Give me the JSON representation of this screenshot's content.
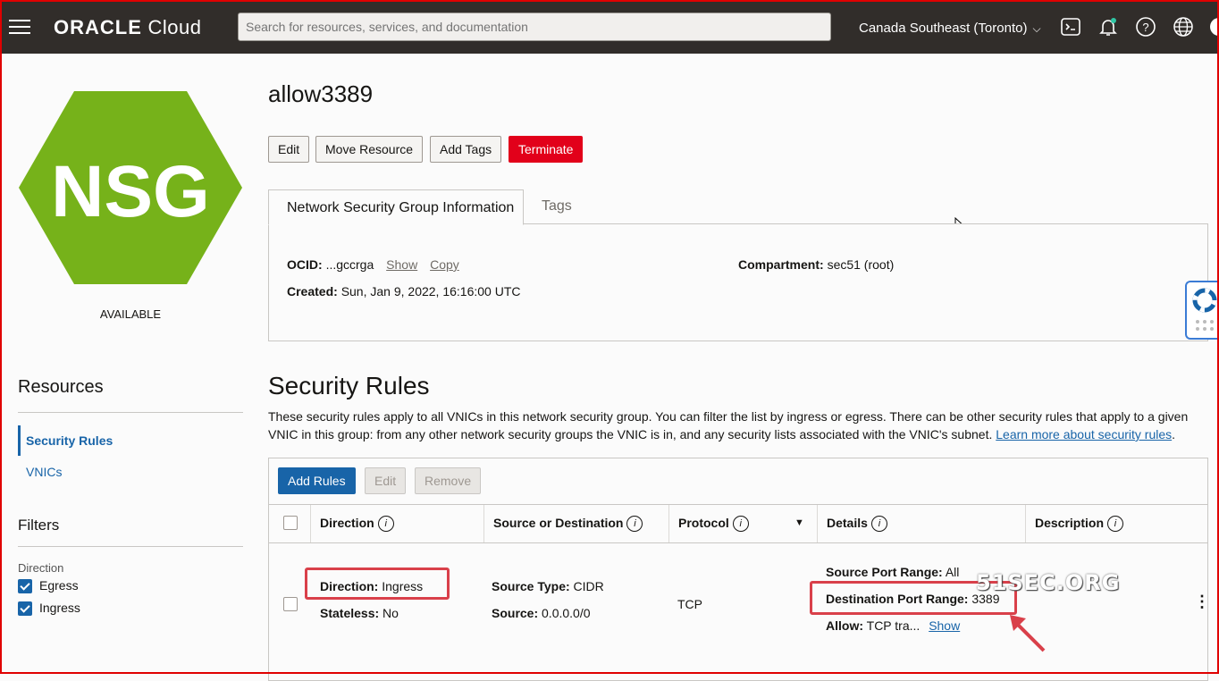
{
  "header": {
    "logo_bold": "ORACLE",
    "logo_light": " Cloud",
    "search_placeholder": "Search for resources, services, and documentation",
    "region": "Canada Southeast (Toronto)",
    "icons": [
      "menu-icon",
      "cloud-shell-icon",
      "notifications-icon",
      "help-icon",
      "language-icon"
    ]
  },
  "badge": {
    "text": "NSG",
    "color": "#76b21a",
    "status": "AVAILABLE"
  },
  "resources": {
    "title": "Resources",
    "items": [
      "Security Rules",
      "VNICs"
    ]
  },
  "filters": {
    "title": "Filters",
    "direction_label": "Direction",
    "options": [
      "Egress",
      "Ingress"
    ]
  },
  "page": {
    "title": "allow3389",
    "actions": [
      "Edit",
      "Move Resource",
      "Add Tags",
      "Terminate"
    ],
    "tabs": [
      "Network Security Group Information",
      "Tags"
    ]
  },
  "info": {
    "ocid_label": "OCID:",
    "ocid_value": "...gccrga",
    "show": "Show",
    "copy": "Copy",
    "created_label": "Created:",
    "created_value": "Sun, Jan 9, 2022, 16:16:00 UTC",
    "compartment_label": "Compartment:",
    "compartment_value": "sec51 (root)"
  },
  "security_rules": {
    "title": "Security Rules",
    "description": "These security rules apply to all VNICs in this network security group. You can filter the list by ingress or egress. There can be other security rules that apply to a given VNIC in this group: from any other network security groups the VNIC is in, and any security lists associated with the VNIC's subnet.",
    "learn_more": "Learn more about security rules",
    "learn_more_period": ".",
    "buttons": [
      "Add Rules",
      "Edit",
      "Remove"
    ],
    "columns": [
      "Direction",
      "Source or Destination",
      "Protocol",
      "Details",
      "Description"
    ],
    "row": {
      "direction_label": "Direction:",
      "direction_value": "Ingress",
      "stateless_label": "Stateless:",
      "stateless_value": "No",
      "source_type_label": "Source Type:",
      "source_type_value": "CIDR",
      "source_label": "Source:",
      "source_value": "0.0.0.0/0",
      "protocol": "TCP",
      "src_port_label": "Source Port Range:",
      "src_port_value": "All",
      "dst_port_label": "Destination Port Range:",
      "dst_port_value": "3389",
      "allow_label": "Allow:",
      "allow_value": "TCP tra...",
      "allow_show": "Show"
    }
  },
  "watermark": "51SEC.ORG",
  "colors": {
    "topbar": "#312d2a",
    "accent": "#1864a8",
    "terminate": "#e2001a",
    "highlight": "#d9404a"
  }
}
